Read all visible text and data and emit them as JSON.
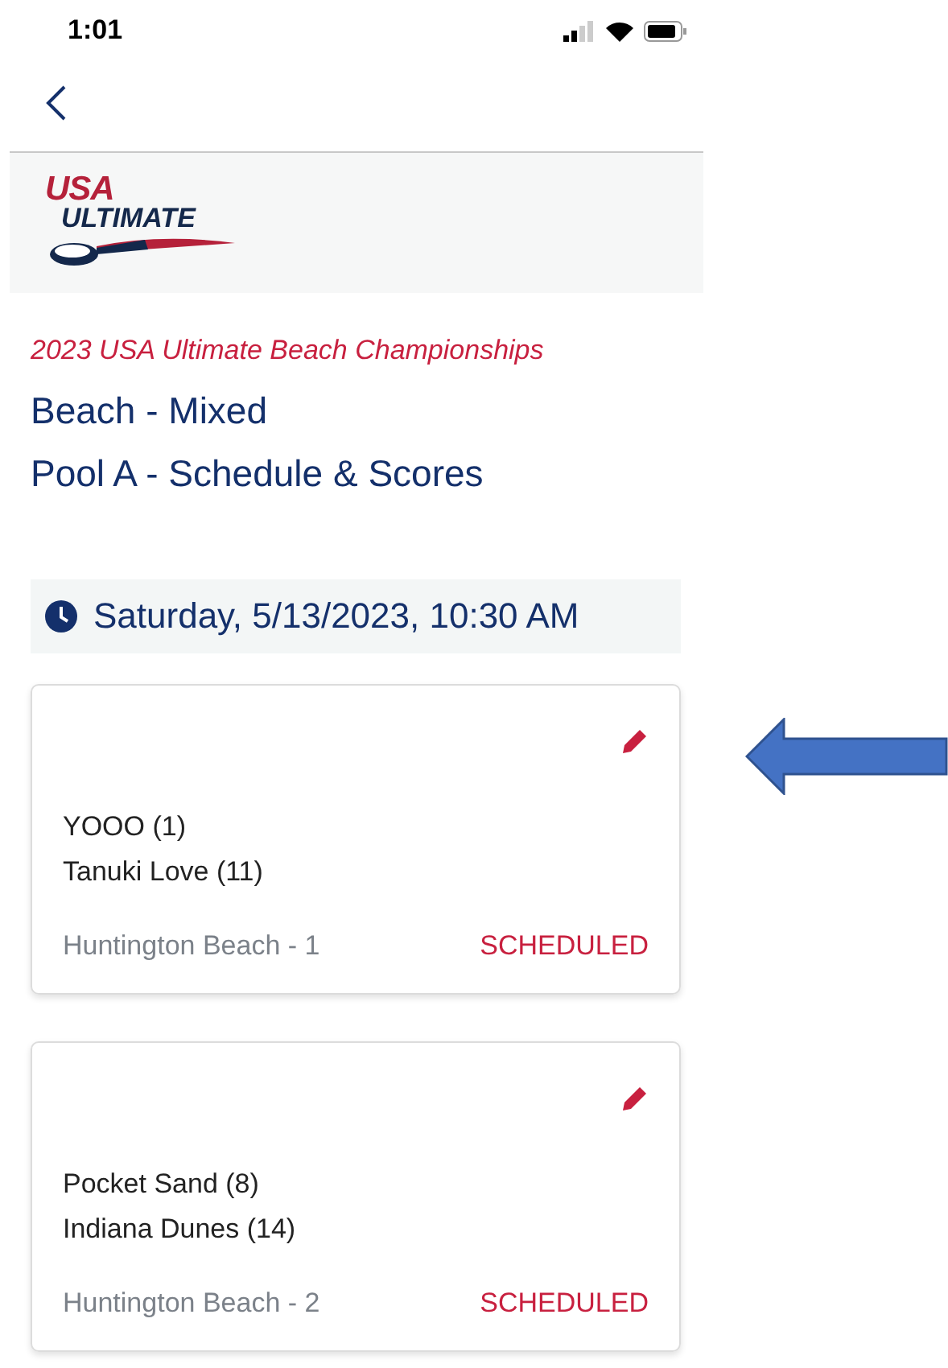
{
  "status_bar": {
    "time": "1:01"
  },
  "logo": {
    "line_1": "USA",
    "line_2": "ULTIMATE"
  },
  "event": "2023 USA Ultimate Beach Championships",
  "division": "Beach - Mixed",
  "pool": "Pool A - Schedule & Scores",
  "time_slot": "Saturday, 5/13/2023, 10:30 AM",
  "games": [
    {
      "team_1": "YOOO (1)",
      "team_2": "Tanuki Love (11)",
      "field": "Huntington Beach - 1",
      "status": "SCHEDULED"
    },
    {
      "team_1": "Pocket Sand (8)",
      "team_2": "Indiana Dunes (14)",
      "field": "Huntington Beach - 2",
      "status": "SCHEDULED"
    }
  ],
  "annotation": {
    "kind": "arrow",
    "color": "#4472c4"
  }
}
